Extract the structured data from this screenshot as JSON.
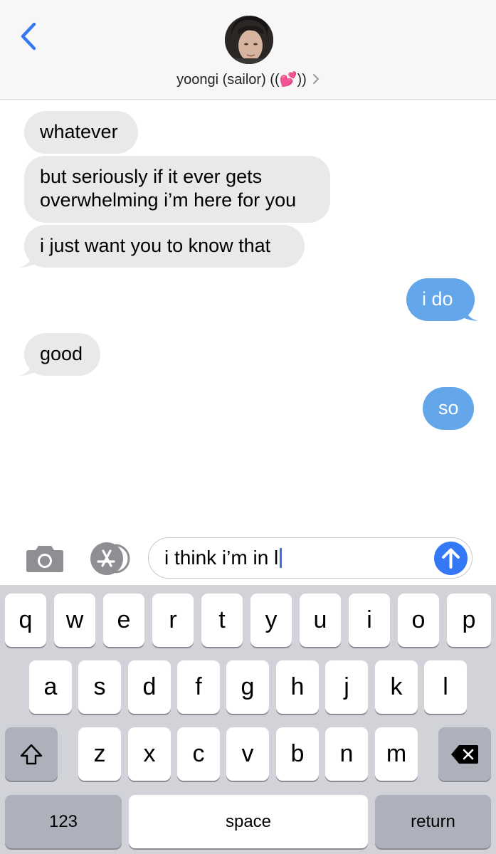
{
  "header": {
    "contact_name": "yoongi (sailor) ((💕))"
  },
  "messages": [
    {
      "id": "m1",
      "direction": "received",
      "lines": [
        "whatever"
      ]
    },
    {
      "id": "m2",
      "direction": "received",
      "lines": [
        "but seriously if it ever gets",
        "overwhelming i’m here for you"
      ]
    },
    {
      "id": "m3",
      "direction": "received",
      "lines": [
        "i just want you to know that"
      ]
    },
    {
      "id": "m4",
      "direction": "sent",
      "lines": [
        "i do"
      ]
    },
    {
      "id": "m5",
      "direction": "received",
      "lines": [
        "good"
      ]
    },
    {
      "id": "m6",
      "direction": "sent",
      "lines": [
        "so"
      ]
    }
  ],
  "composer": {
    "value": "i think i’m in l"
  },
  "keyboard": {
    "row1": [
      "q",
      "w",
      "e",
      "r",
      "t",
      "y",
      "u",
      "i",
      "o",
      "p"
    ],
    "row2": [
      "a",
      "s",
      "d",
      "f",
      "g",
      "h",
      "j",
      "k",
      "l"
    ],
    "row3": [
      "z",
      "x",
      "c",
      "v",
      "b",
      "n",
      "m"
    ],
    "numbers_label": "123",
    "space_label": "space",
    "return_label": "return"
  },
  "colors": {
    "accent": "#3478f6",
    "sent_bubble": "#64a6ea",
    "received_bubble": "#e9e9eb",
    "keyboard_bg": "#d1d3d9"
  },
  "icons": [
    "back-chevron-icon",
    "contact-avatar",
    "chevron-right-icon",
    "camera-icon",
    "app-store-icon",
    "send-arrow-icon",
    "shift-icon",
    "delete-icon"
  ]
}
